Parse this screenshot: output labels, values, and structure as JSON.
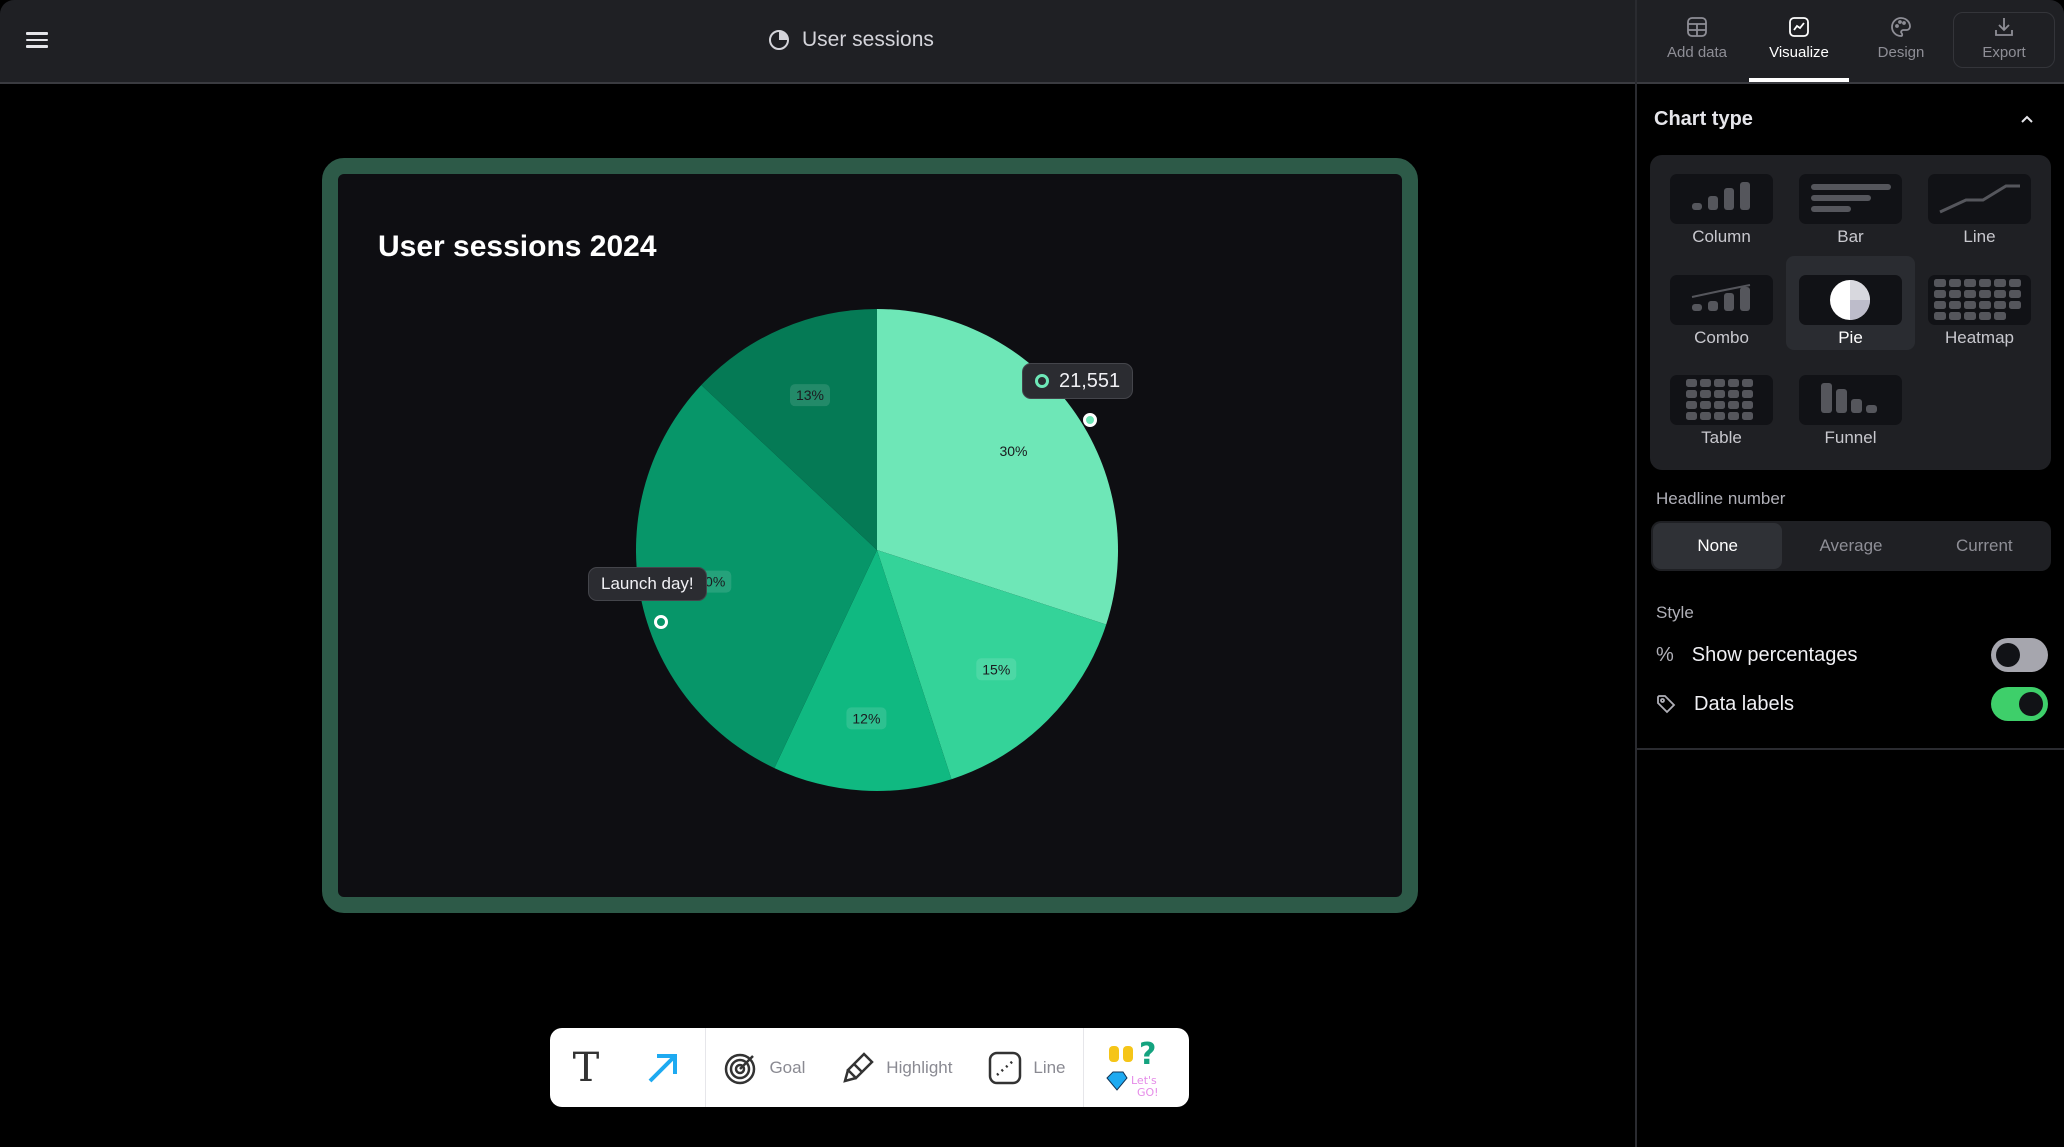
{
  "header": {
    "title": "User sessions",
    "menu_icon": "hamburger-icon",
    "title_icon": "pie-chart-icon"
  },
  "sidebar": {
    "tabs": [
      {
        "label": "Add data",
        "icon": "table-icon"
      },
      {
        "label": "Visualize",
        "icon": "chart-icon",
        "active": true
      },
      {
        "label": "Design",
        "icon": "palette-icon"
      },
      {
        "label": "Export",
        "icon": "download-icon"
      }
    ],
    "chart_type": {
      "title": "Chart type",
      "selected": "Pie",
      "options": [
        "Column",
        "Bar",
        "Line",
        "Combo",
        "Pie",
        "Heatmap",
        "Table",
        "Funnel"
      ]
    },
    "headline": {
      "label": "Headline number",
      "options": [
        "None",
        "Average",
        "Current"
      ],
      "selected": "None"
    },
    "style": {
      "label": "Style",
      "show_percentages": {
        "label": "Show percentages",
        "on": false
      },
      "data_labels": {
        "label": "Data labels",
        "on": true
      }
    },
    "accent": "#3ecf6a"
  },
  "card": {
    "title": "User sessions 2024",
    "tooltip_value": "21,551",
    "annotation": "Launch day!"
  },
  "chart_data": {
    "type": "pie",
    "title": "User sessions 2024",
    "values": [
      30,
      15,
      12,
      30,
      13
    ],
    "labels": [
      "30%",
      "15%",
      "12%",
      "30%",
      "13%"
    ],
    "colors": [
      "#6ee7b7",
      "#34d399",
      "#10b981",
      "#079669",
      "#057a55"
    ]
  },
  "toolbar": {
    "goal": "Goal",
    "highlight": "Highlight",
    "line": "Line",
    "sticker_text": "Let's GO!"
  }
}
